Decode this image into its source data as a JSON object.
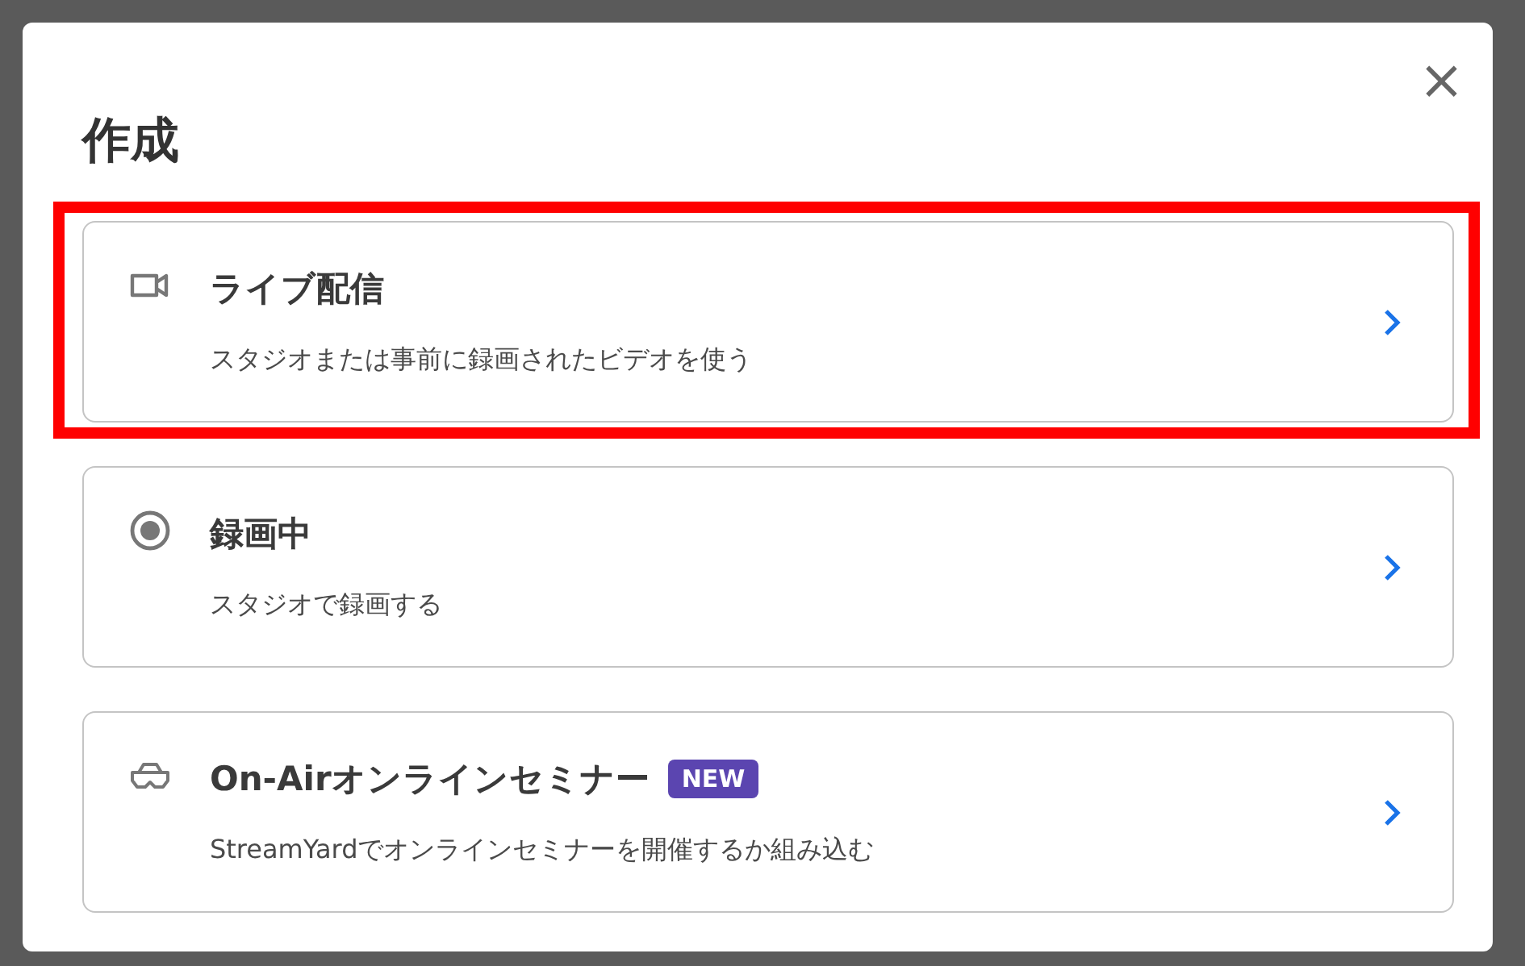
{
  "dialog": {
    "title": "作成",
    "close_label": "×"
  },
  "options": [
    {
      "kind": "video",
      "title": "ライブ配信",
      "description": "スタジオまたは事前に録画されたビデオを使う",
      "highlighted": true
    },
    {
      "kind": "record",
      "title": "録画中",
      "description": "スタジオで録画する",
      "highlighted": false
    },
    {
      "kind": "webinar",
      "title": "On-Airオンラインセミナー",
      "badge": "NEW",
      "description": "StreamYardでオンラインセミナーを開催するか組み込む",
      "highlighted": false
    }
  ]
}
